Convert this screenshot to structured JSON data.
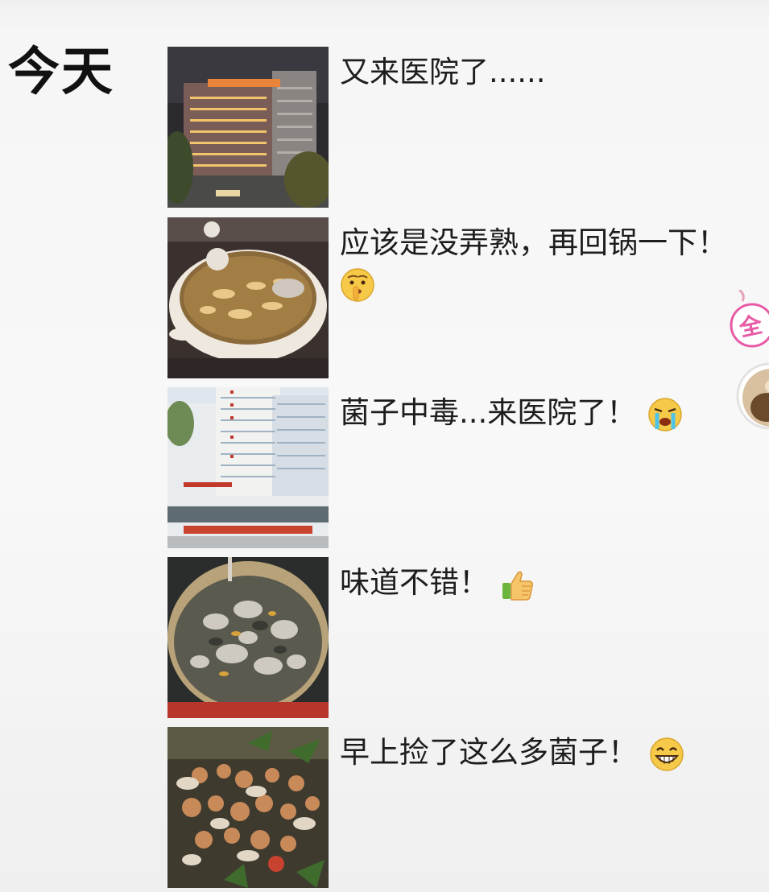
{
  "date_label": "今天",
  "posts": [
    {
      "caption": "又来医院了......",
      "image": "hospital-night-photo",
      "emoji": ""
    },
    {
      "caption": "应该是没弄熟，再回锅一下！",
      "image": "mushroom-soup-pot-photo",
      "emoji": "shush-face-emoji"
    },
    {
      "caption": "菌子中毒...来医院了！",
      "image": "hospital-building-photo",
      "emoji": "crying-face-emoji"
    },
    {
      "caption": "味道不错！",
      "image": "mushroom-hotpot-photo",
      "emoji": "thumbs-up-emoji"
    },
    {
      "caption": "早上捡了这么多菌子！",
      "image": "wild-mushrooms-ground-photo",
      "emoji": "grinning-face-emoji"
    }
  ],
  "sticker": {
    "text": "全"
  },
  "colors": {
    "background": "#f6f6f6",
    "text": "#1d1d1d",
    "emoji_yellow": "#f7c948",
    "tears": "#4fc3e8",
    "sticker_pink": "#e85aa6"
  }
}
